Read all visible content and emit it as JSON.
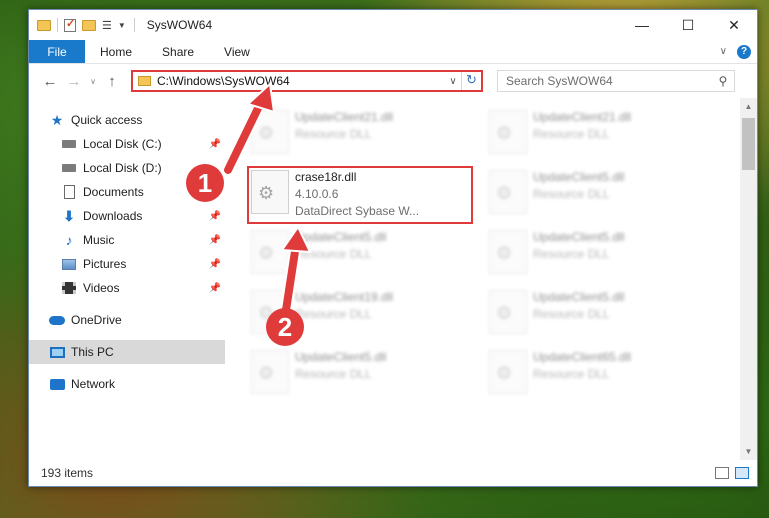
{
  "window": {
    "title": "SysWOW64"
  },
  "ribbon": {
    "file_tab": "File",
    "tabs": [
      "Home",
      "Share",
      "View"
    ]
  },
  "navbar": {
    "address": "C:\\Windows\\SysWOW64",
    "search_placeholder": "Search SysWOW64"
  },
  "sidebar": {
    "quick_access": "Quick access",
    "items": [
      {
        "label": "Local Disk (C:)",
        "icon": "drive-icon",
        "pinned": true
      },
      {
        "label": "Local Disk (D:)",
        "icon": "drive-icon",
        "pinned": false
      },
      {
        "label": "Documents",
        "icon": "documents-icon",
        "pinned": true
      },
      {
        "label": "Downloads",
        "icon": "downloads-icon",
        "pinned": true
      },
      {
        "label": "Music",
        "icon": "music-icon",
        "pinned": true
      },
      {
        "label": "Pictures",
        "icon": "pictures-icon",
        "pinned": true
      },
      {
        "label": "Videos",
        "icon": "videos-icon",
        "pinned": true
      }
    ],
    "onedrive": "OneDrive",
    "this_pc": "This PC",
    "network": "Network"
  },
  "files": {
    "highlighted": {
      "name": "crase18r.dll",
      "version": "4.10.0.6",
      "description": "DataDirect Sybase W..."
    },
    "left_col": [
      {
        "name": "UpdateClient21.dll",
        "sub": "Resource DLL"
      },
      {
        "name": "UpdateClient5.dll",
        "sub": "Resource DLL"
      },
      {
        "name": "UpdateClient19.dll",
        "sub": "Resource DLL"
      },
      {
        "name": "UpdateClient5.dll",
        "sub": "Resource DLL"
      }
    ],
    "right_col": [
      {
        "name": "UpdateClient21.dll",
        "sub": "Resource DLL"
      },
      {
        "name": "UpdateClient5.dll",
        "sub": "Resource DLL"
      },
      {
        "name": "UpdateClient5.dll",
        "sub": "Resource DLL"
      },
      {
        "name": "UpdateClient5.dll",
        "sub": "Resource DLL"
      },
      {
        "name": "UpdateClient65.dll",
        "sub": "Resource DLL"
      }
    ]
  },
  "status": {
    "item_count": "193 items"
  },
  "annotations": {
    "badge1": "1",
    "badge2": "2",
    "color": "#e03b3b"
  }
}
